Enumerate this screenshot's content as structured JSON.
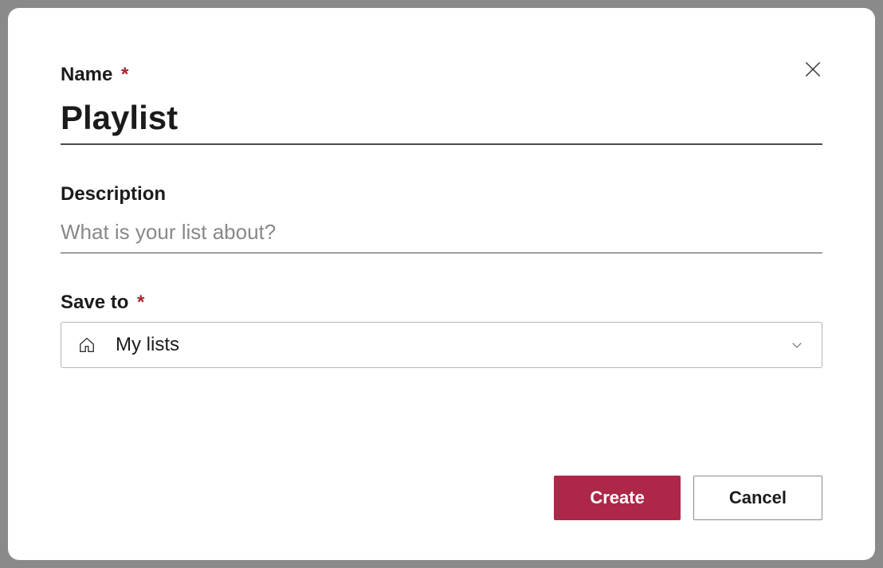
{
  "form": {
    "name": {
      "label": "Name",
      "value": "Playlist",
      "required": true
    },
    "description": {
      "label": "Description",
      "value": "",
      "placeholder": "What is your list about?",
      "required": false
    },
    "saveTo": {
      "label": "Save to",
      "selected": "My lists",
      "required": true
    }
  },
  "buttons": {
    "create": "Create",
    "cancel": "Cancel"
  },
  "requiredMark": "*"
}
